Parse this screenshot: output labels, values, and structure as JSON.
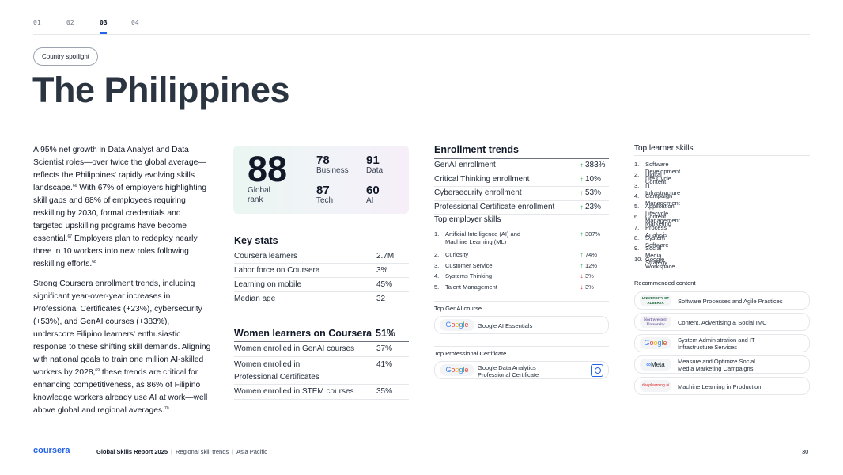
{
  "tabs": [
    "01",
    "02",
    "03",
    "04"
  ],
  "badge": "Country spotlight",
  "title": "The Philippines",
  "paragraph1": {
    "p1": "A 95% net growth in Data Analyst and Data Scientist roles—over twice the global average—reflects the Philippines' rapidly evolving skills landscape.",
    "r1": "66",
    "p2": " With 67% of employers highlighting skill gaps and 68% of employees requiring reskilling by 2030, formal credentials and targeted upskilling programs have become essential.",
    "r2": "67",
    "p3": " Employers plan to redeploy nearly three in 10 workers into new roles following reskilling efforts.",
    "r3": "68"
  },
  "paragraph2": {
    "p1": "Strong Coursera enrollment trends, including significant year-over-year increases in Professional Certificates (+23%), cybersecurity (+53%), and GenAI courses (+383%), underscore Filipino learners' enthusiastic response to these shifting skill demands. Aligning with national goals to train one million AI-skilled workers by 2028,",
    "r1": "69",
    "p2": " these trends are critical for enhancing competitiveness, as 86% of Filipino knowledge workers already use AI at work—well above global and regional averages.",
    "r2": "70"
  },
  "rank": {
    "global": "88",
    "global_label": "Global rank",
    "business": "78",
    "business_label": "Business",
    "data": "91",
    "data_label": "Data",
    "tech": "87",
    "tech_label": "Tech",
    "ai": "60",
    "ai_label": "AI"
  },
  "key_stats": {
    "title": "Key stats",
    "rows": [
      {
        "k": "Coursera learners",
        "v": "2.7M"
      },
      {
        "k": "Labor force on Coursera",
        "v": "3%"
      },
      {
        "k": "Learning on mobile",
        "v": "45%"
      },
      {
        "k": "Median age",
        "v": "32"
      }
    ]
  },
  "women": {
    "title": "Women learners on Coursera",
    "value": "51%",
    "rows": [
      {
        "k": "Women enrolled in GenAI courses",
        "v": "37%"
      },
      {
        "k": "Women enrolled in Professional Certificates",
        "v": "41%"
      },
      {
        "k": "Women enrolled in STEM courses",
        "v": "35%"
      }
    ]
  },
  "enrollment": {
    "title": "Enrollment trends",
    "rows": [
      {
        "k": "GenAI enrollment",
        "v": "383%"
      },
      {
        "k": "Critical Thinking enrollment",
        "v": "10%"
      },
      {
        "k": "Cybersecurity enrollment",
        "v": "53%"
      },
      {
        "k": "Professional Certificate enrollment",
        "v": "23%"
      }
    ]
  },
  "employer_skills": {
    "title": "Top employer skills",
    "items": [
      {
        "n": "1.",
        "t": "Artificial Intelligence (AI) and Machine Learning (ML)",
        "v": "307%",
        "dir": "up"
      },
      {
        "n": "2.",
        "t": "Curiosity",
        "v": "74%",
        "dir": "up"
      },
      {
        "n": "3.",
        "t": "Customer Service",
        "v": "12%",
        "dir": "up"
      },
      {
        "n": "4.",
        "t": "Systems Thinking",
        "v": "3%",
        "dir": "down"
      },
      {
        "n": "5.",
        "t": "Talent Management",
        "v": "3%",
        "dir": "down"
      }
    ]
  },
  "genai_course": {
    "label": "Top GenAI course",
    "name": "Google AI Essentials"
  },
  "prof_cert": {
    "label": "Top Professional Certificate",
    "name": "Google Data Analytics Professional Certificate"
  },
  "learner_skills": {
    "title": "Top learner skills",
    "items": [
      {
        "n": "1.",
        "t": "Software Development Life Cycle"
      },
      {
        "n": "2.",
        "t": "Digital Content"
      },
      {
        "n": "3.",
        "t": "IT Infrastructure"
      },
      {
        "n": "4.",
        "t": "Campaign Management"
      },
      {
        "n": "5.",
        "t": "Application Lifecycle Management"
      },
      {
        "n": "6.",
        "t": "Content Marketing"
      },
      {
        "n": "7.",
        "t": "Process Analysis"
      },
      {
        "n": "8.",
        "t": "System Software"
      },
      {
        "n": "9.",
        "t": "Social Media Strategy"
      },
      {
        "n": "10.",
        "t": "Google Workspace"
      }
    ]
  },
  "recommended": {
    "title": "Recommended content",
    "items": [
      {
        "logo": "UNIVERSITY OF ALBERTA",
        "name": "Software Processes and Agile Practices"
      },
      {
        "logo": "Northwestern University",
        "name": "Content, Advertising & Social IMC"
      },
      {
        "logo": "Google",
        "name": "System Administration and IT Infrastructure Services"
      },
      {
        "logo": "Meta",
        "name": "Measure and Optimize Social Media Marketing Campaigns"
      },
      {
        "logo": "deeplearning.ai",
        "name": "Machine Learning in Production"
      }
    ]
  },
  "logos": {
    "google": [
      "G",
      "o",
      "o",
      "g",
      "l",
      "e"
    ]
  },
  "footer": {
    "brand": "coursera",
    "report": "Global Skills Report 2025",
    "section": "Regional skill trends",
    "region": "Asia Pacific",
    "page": "30"
  }
}
